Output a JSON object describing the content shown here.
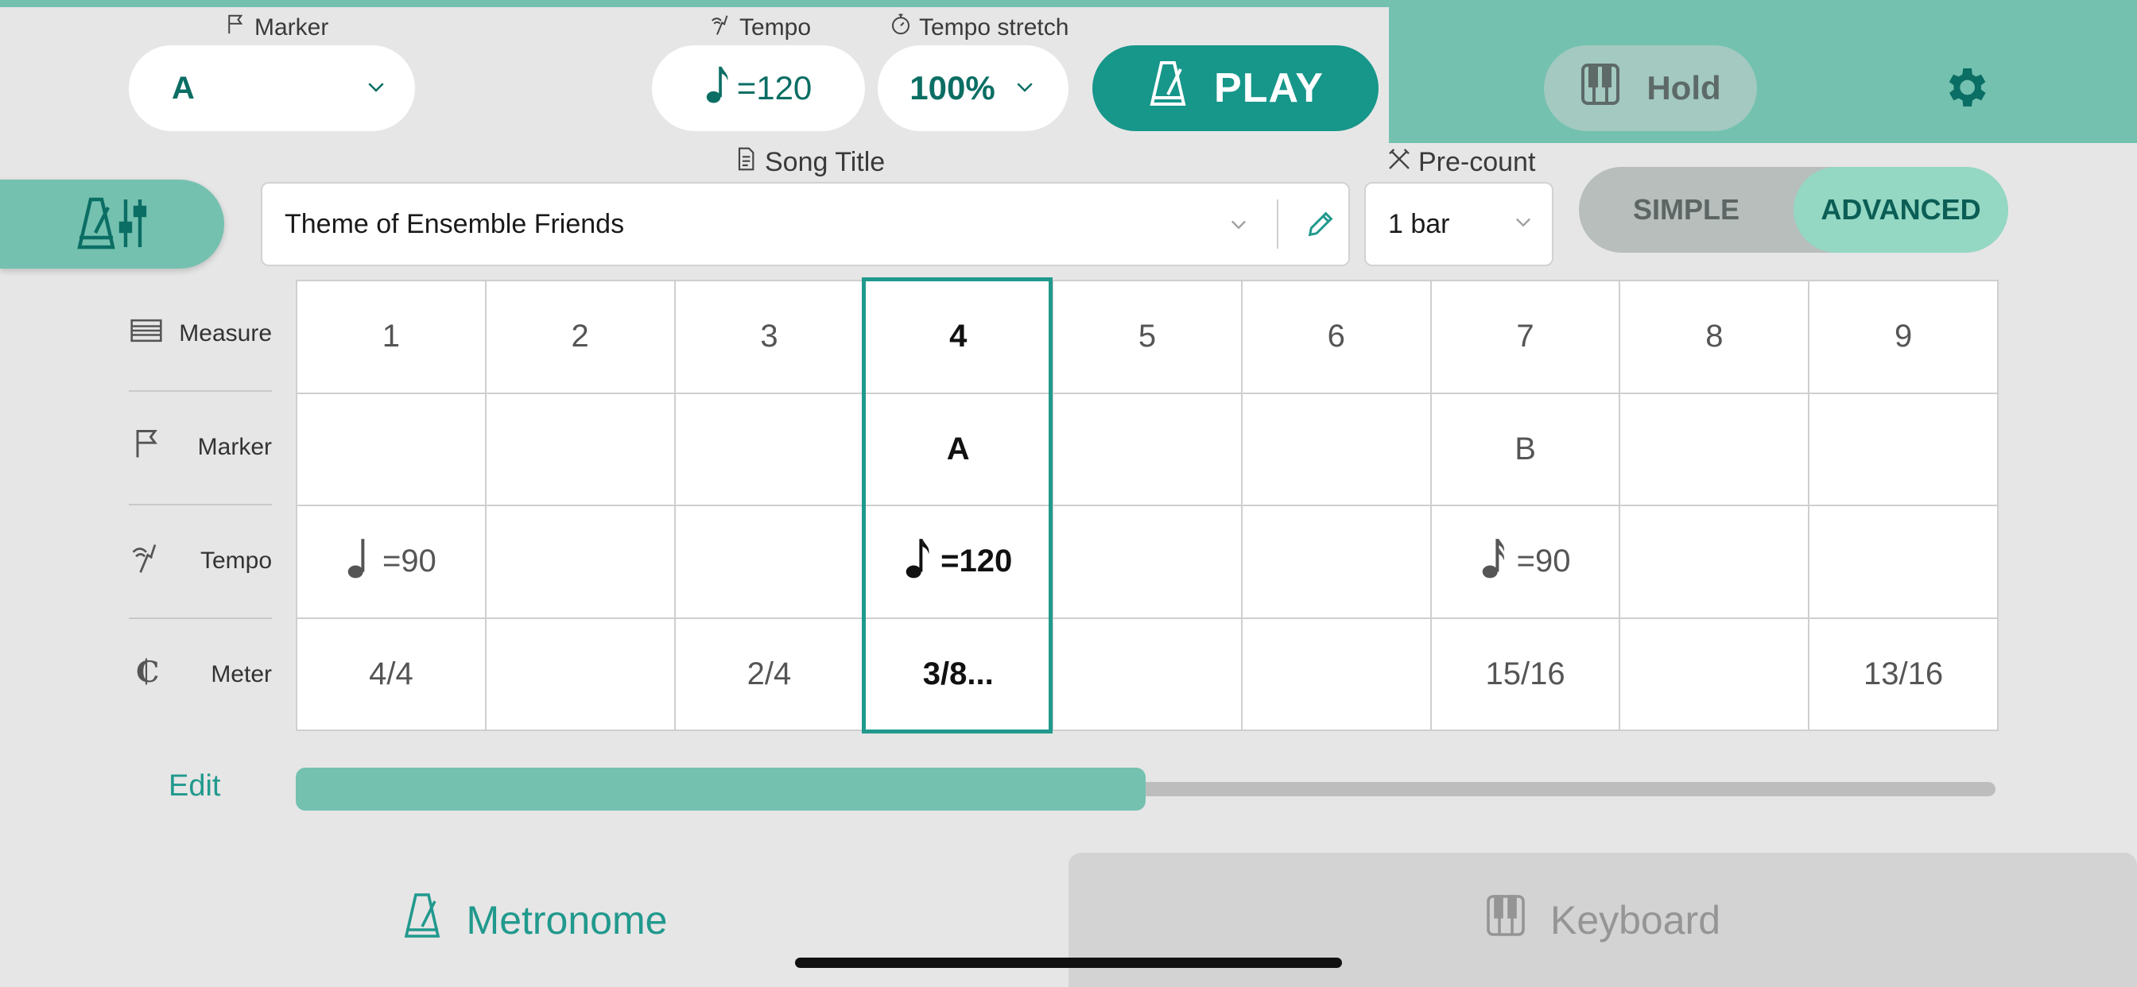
{
  "header": {
    "marker_label": "Marker",
    "marker_value": "A",
    "tempo_label": "Tempo",
    "tempo_value": "=120",
    "stretch_label": "Tempo stretch",
    "stretch_value": "100%",
    "play_label": "PLAY",
    "hold_label": "Hold"
  },
  "song": {
    "label": "Song Title",
    "title": "Theme of Ensemble Friends"
  },
  "precount": {
    "label": "Pre-count",
    "value": "1 bar"
  },
  "mode": {
    "simple": "SIMPLE",
    "advanced": "ADVANCED",
    "selected": "ADVANCED"
  },
  "rows": {
    "measure": "Measure",
    "marker": "Marker",
    "tempo": "Tempo",
    "meter": "Meter"
  },
  "grid": {
    "measures": [
      "1",
      "2",
      "3",
      "4",
      "5",
      "6",
      "7",
      "8",
      "9"
    ],
    "markers": [
      "",
      "",
      "",
      "A",
      "",
      "",
      "B",
      "",
      ""
    ],
    "tempos": [
      "=90",
      "",
      "",
      "=120",
      "",
      "",
      "=90",
      "",
      ""
    ],
    "tempo_notes": [
      "quarter-note-icon",
      "",
      "",
      "eighth-note-icon",
      "",
      "",
      "dotted-sixteenth-note-icon",
      "",
      ""
    ],
    "meters": [
      "4/4",
      "",
      "2/4",
      "3/8...",
      "",
      "",
      "15/16",
      "",
      "13/16"
    ],
    "selected_measure": "4"
  },
  "footer": {
    "edit_label": "Edit",
    "progress": 0.5
  },
  "tabs": {
    "metronome": "Metronome",
    "keyboard": "Keyboard",
    "active": "Metronome"
  },
  "colors": {
    "accent": "#21998d",
    "accent_light": "#74c1b0",
    "play": "#17968a",
    "advanced": "#94d7c3"
  }
}
